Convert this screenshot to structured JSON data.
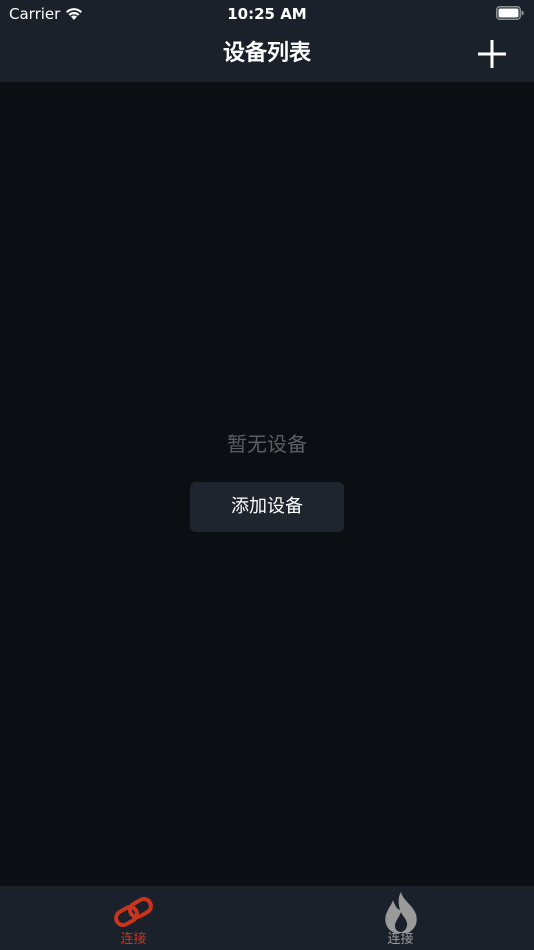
{
  "status_bar": {
    "carrier": "Carrier",
    "time": "10:25 AM"
  },
  "nav": {
    "title": "设备列表",
    "add_icon": "plus-icon"
  },
  "empty_state": {
    "message": "暂无设备",
    "add_button_label": "添加设备"
  },
  "tab_bar": {
    "tabs": [
      {
        "label": "连接",
        "icon": "link-icon",
        "active": true
      },
      {
        "label": "连接",
        "icon": "fire-icon",
        "active": false
      }
    ]
  },
  "colors": {
    "background": "#0b0f13",
    "bar_background": "#1b212a",
    "button_background": "#1f252e",
    "active_tab": "#c8351c",
    "inactive_tab": "#9a9a9a",
    "muted_text": "#5a5e63"
  }
}
